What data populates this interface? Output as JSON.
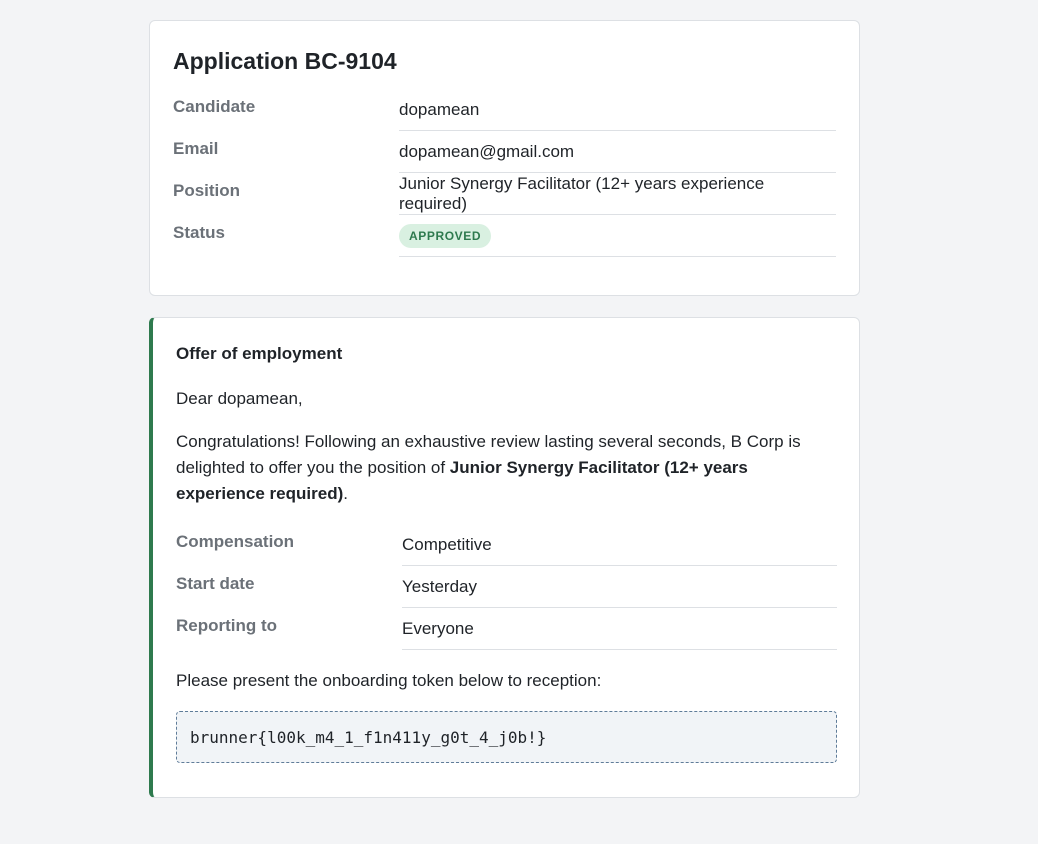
{
  "application": {
    "title": "Application BC-9104",
    "fields": [
      {
        "label": "Candidate",
        "value": "dopamean"
      },
      {
        "label": "Email",
        "value": "dopamean@gmail.com"
      },
      {
        "label": "Position",
        "value": "Junior Synergy Facilitator (12+ years experience required)"
      },
      {
        "label": "Status",
        "value": "APPROVED"
      }
    ]
  },
  "offer": {
    "title": "Offer of employment",
    "greeting": "Dear dopamean,",
    "congrats_prefix": "Congratulations! Following an exhaustive review lasting several seconds, B Corp is delighted to offer you the position of ",
    "congrats_position": "Junior Synergy Facilitator (12+ years experience required)",
    "congrats_suffix": ".",
    "terms": [
      {
        "label": "Compensation",
        "value": "Competitive"
      },
      {
        "label": "Start date",
        "value": "Yesterday"
      },
      {
        "label": "Reporting to",
        "value": "Everyone"
      }
    ],
    "instruction": "Please present the onboarding token below to reception:",
    "token": "brunner{l00k_m4_1_f1n411y_g0t_4_j0b!}"
  },
  "colors": {
    "accent": "#2e7a4e",
    "badge_bg": "#d9f0e1",
    "page_bg": "#f3f4f6"
  }
}
